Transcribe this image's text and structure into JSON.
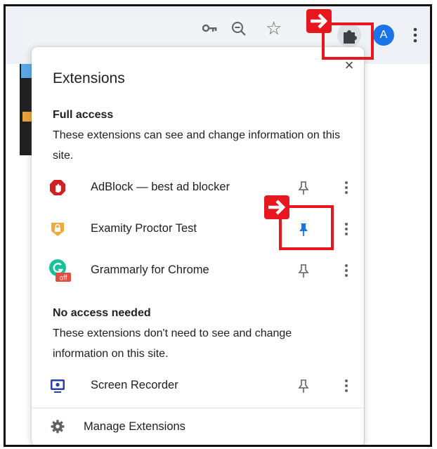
{
  "toolbar": {
    "profile_initial": "A",
    "icons": [
      "key-icon",
      "zoom-icon",
      "star-icon",
      "extensions-puzzle-icon",
      "more-vert-icon"
    ]
  },
  "popup": {
    "title": "Extensions",
    "close_glyph": "×",
    "full_access": {
      "heading": "Full access",
      "description": "These extensions can see and change information on this site.",
      "items": [
        {
          "label": "AdBlock — best ad blocker",
          "pinned": false,
          "icon": "adblock-icon"
        },
        {
          "label": "Examity Proctor Test",
          "pinned": true,
          "icon": "examity-icon"
        },
        {
          "label": "Grammarly for Chrome",
          "pinned": false,
          "icon": "grammarly-icon",
          "badge": "off"
        }
      ]
    },
    "no_access": {
      "heading": "No access needed",
      "description": "These extensions don't need to see and change information on this site.",
      "items": [
        {
          "label": "Screen Recorder",
          "pinned": false,
          "icon": "screen-recorder-icon"
        }
      ]
    },
    "manage_label": "Manage Extensions"
  },
  "colors": {
    "annotation_red": "#e8161e",
    "pin_active": "#1a73e8",
    "pin_inactive": "#5f6368",
    "profile_blue": "#1a73e8"
  }
}
